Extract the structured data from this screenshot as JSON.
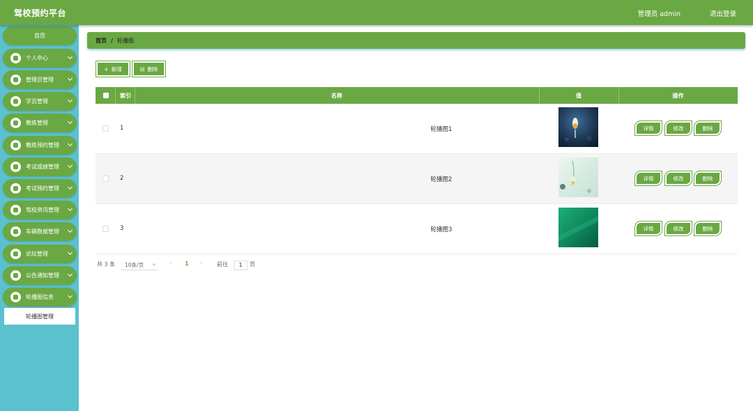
{
  "app": {
    "title": "驾校预约平台",
    "user": "管理员 admin",
    "logout": "退出登录"
  },
  "sidebar": {
    "home": "首页",
    "items": [
      {
        "label": "个人中心",
        "icon": "user-icon"
      },
      {
        "label": "管理员管理",
        "icon": "admin-icon"
      },
      {
        "label": "学员管理",
        "icon": "grid-icon"
      },
      {
        "label": "教练管理",
        "icon": "grid-icon"
      },
      {
        "label": "教练预约管理",
        "icon": "calendar-icon"
      },
      {
        "label": "考试成绩管理",
        "icon": "grid-icon"
      },
      {
        "label": "考试预约管理",
        "icon": "trophy-icon"
      },
      {
        "label": "驾校资讯管理",
        "icon": "list-icon"
      },
      {
        "label": "车辆数据管理",
        "icon": "grid-icon"
      },
      {
        "label": "论坛管理",
        "icon": "forum-icon"
      },
      {
        "label": "公告通知管理",
        "icon": "bell-icon"
      },
      {
        "label": "轮播图信息",
        "icon": "image-icon"
      }
    ],
    "sub_item": "轮播图管理"
  },
  "breadcrumb": {
    "home": "首页",
    "sep": "/",
    "current": "轮播图"
  },
  "actions": {
    "add": "新增",
    "add_icon": "+",
    "delete": "删除",
    "delete_icon": "⊟"
  },
  "table": {
    "columns": [
      "索引",
      "名称",
      "值",
      "操作"
    ],
    "rows": [
      {
        "index": "1",
        "name": "轮播图1",
        "image": "dark-blue-photo"
      },
      {
        "index": "2",
        "name": "轮播图2",
        "image": "light-green-photo"
      },
      {
        "index": "3",
        "name": "轮播图3",
        "image": "green-gradient-photo"
      }
    ],
    "row_actions": {
      "detail": "详情",
      "edit": "修改",
      "delete": "删除"
    }
  },
  "pagination": {
    "total": "共 3 条",
    "page_size": "10条/页",
    "prev": "‹",
    "current_page": "1",
    "next": "›",
    "goto_label": "前往",
    "goto_value": "1",
    "page_suffix": "页"
  },
  "colors": {
    "primary": "#6aa843",
    "sidebar_bg": "#5bc1cf"
  }
}
